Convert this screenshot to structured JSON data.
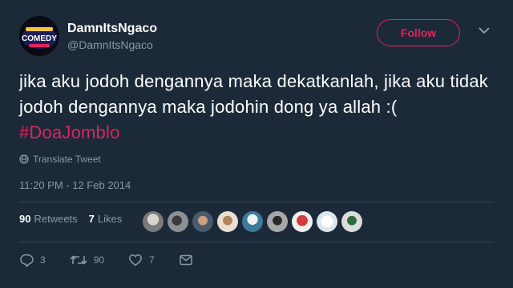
{
  "user": {
    "display_name": "DamnItsNgaco",
    "handle": "@DamnItsNgaco",
    "avatar_logo_text": "COMEDY"
  },
  "follow_label": "Follow",
  "tweet": {
    "text": "jika aku jodoh dengannya maka dekatkanlah, jika aku tidak jodoh dengannya maka jodohin dong ya allah :(",
    "hashtag": "#DoaJomblo"
  },
  "translate_label": "Translate Tweet",
  "timestamp": "11:20 PM - 12 Feb 2014",
  "stats": {
    "retweets_count": "90",
    "retweets_label": "Retweets",
    "likes_count": "7",
    "likes_label": "Likes"
  },
  "actions": {
    "replies": "3",
    "retweets": "90",
    "likes": "7"
  },
  "colors": {
    "background": "#1c2938",
    "accent": "#e0245e",
    "muted": "#8899a6",
    "divider": "#38444d"
  },
  "icons": [
    "chevron-down-icon",
    "globe-icon",
    "reply-icon",
    "retweet-icon",
    "heart-icon",
    "message-icon"
  ]
}
